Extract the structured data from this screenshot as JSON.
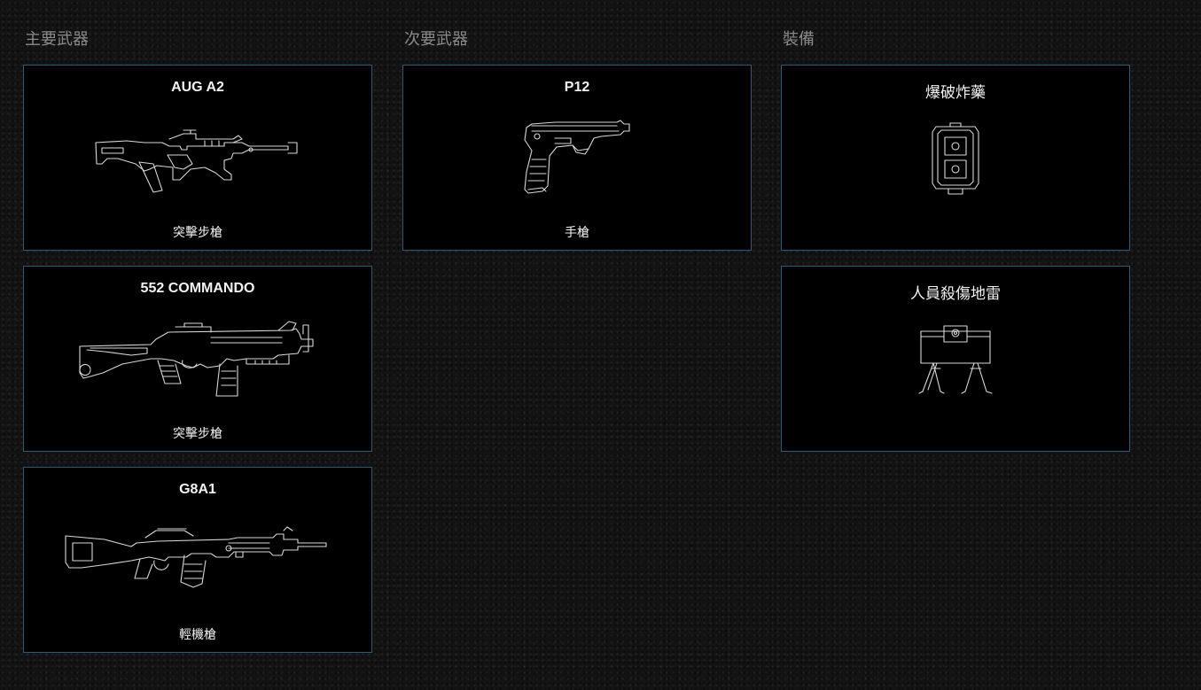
{
  "columns": {
    "primary": {
      "title": "主要武器",
      "items": [
        {
          "name": "AUG A2",
          "type": "突擊步槍",
          "icon": "aug-a2-rifle-icon"
        },
        {
          "name": "552 COMMANDO",
          "type": "突擊步槍",
          "icon": "552-commando-rifle-icon"
        },
        {
          "name": "G8A1",
          "type": "輕機槍",
          "icon": "g8a1-lmg-icon"
        }
      ]
    },
    "secondary": {
      "title": "次要武器",
      "items": [
        {
          "name": "P12",
          "type": "手槍",
          "icon": "p12-pistol-icon"
        }
      ]
    },
    "gadget": {
      "title": "裝備",
      "items": [
        {
          "name": "爆破炸藥",
          "icon": "breach-charge-icon"
        },
        {
          "name": "人員殺傷地雷",
          "icon": "claymore-mine-icon"
        }
      ]
    }
  },
  "colors": {
    "background": "#131313",
    "card_background": "#000000",
    "card_border": "#2e5a74",
    "section_title": "#8a8a8a",
    "card_text": "#f2f2f2",
    "line_art": "#d8d8d8"
  }
}
